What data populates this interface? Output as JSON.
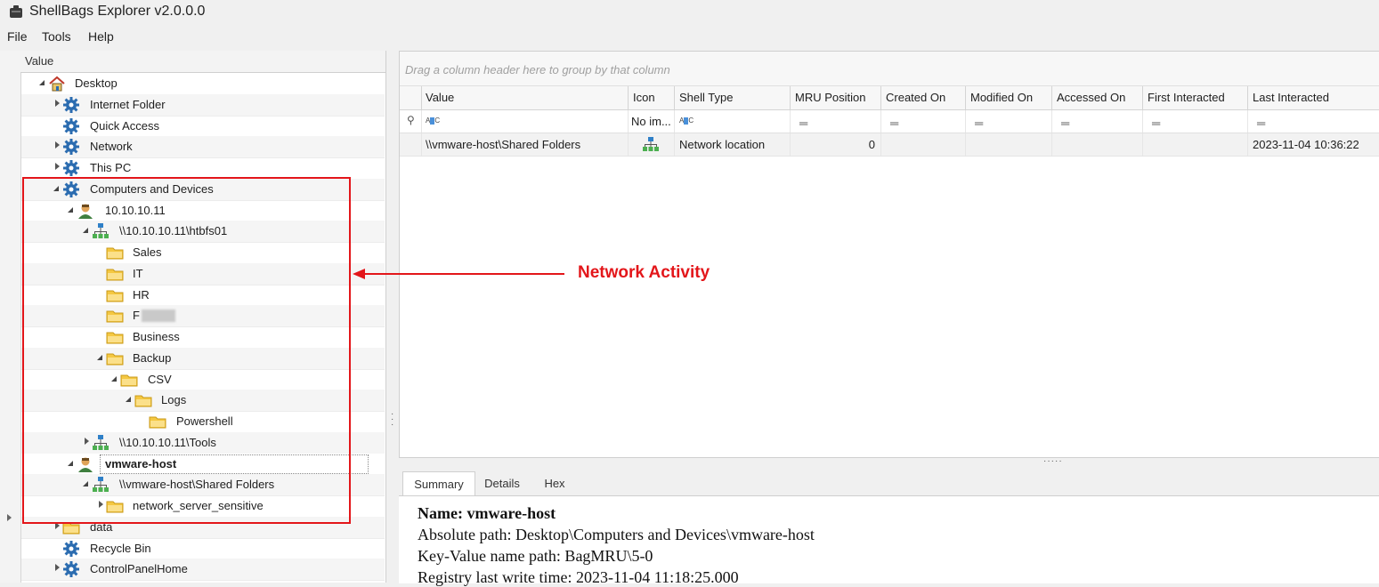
{
  "window": {
    "title": "ShellBags Explorer v2.0.0.0"
  },
  "menu": [
    "File",
    "Tools",
    "Help"
  ],
  "tree": {
    "header": "Value",
    "nodes": [
      {
        "label": "Desktop",
        "icon": "home-icon",
        "level": 0,
        "state": "expanded"
      },
      {
        "label": "Internet Folder",
        "icon": "gear-icon",
        "level": 1,
        "state": "collapsed"
      },
      {
        "label": "Quick Access",
        "icon": "gear-icon",
        "level": 1,
        "state": "none"
      },
      {
        "label": "Network",
        "icon": "gear-icon",
        "level": 1,
        "state": "collapsed"
      },
      {
        "label": "This PC",
        "icon": "gear-icon",
        "level": 1,
        "state": "collapsed"
      },
      {
        "label": "Computers and Devices",
        "icon": "gear-icon",
        "level": 1,
        "state": "expanded"
      },
      {
        "label": "10.10.10.11",
        "icon": "user-icon",
        "level": 2,
        "state": "expanded"
      },
      {
        "label": "\\\\10.10.10.11\\htbfs01",
        "icon": "network-icon",
        "level": 3,
        "state": "expanded"
      },
      {
        "label": "Sales",
        "icon": "folder-icon",
        "level": 4,
        "state": "none"
      },
      {
        "label": "IT",
        "icon": "folder-icon",
        "level": 4,
        "state": "none"
      },
      {
        "label": "HR",
        "icon": "folder-icon",
        "level": 4,
        "state": "none"
      },
      {
        "label": "F",
        "icon": "folder-icon",
        "level": 4,
        "state": "none",
        "redacted": true
      },
      {
        "label": "Business",
        "icon": "folder-icon",
        "level": 4,
        "state": "none"
      },
      {
        "label": "Backup",
        "icon": "folder-icon",
        "level": 4,
        "state": "expanded"
      },
      {
        "label": "CSV",
        "icon": "folder-icon",
        "level": 5,
        "state": "expanded"
      },
      {
        "label": "Logs",
        "icon": "folder-icon",
        "level": 6,
        "state": "expanded"
      },
      {
        "label": "Powershell",
        "icon": "folder-icon",
        "level": 7,
        "state": "none"
      },
      {
        "label": "\\\\10.10.10.11\\Tools",
        "icon": "network-icon",
        "level": 3,
        "state": "collapsed"
      },
      {
        "label": "vmware-host",
        "icon": "user-icon",
        "level": 2,
        "state": "expanded",
        "selected": true
      },
      {
        "label": "\\\\vmware-host\\Shared Folders",
        "icon": "network-icon",
        "level": 3,
        "state": "expanded"
      },
      {
        "label": "network_server_sensitive",
        "icon": "folder-icon",
        "level": 4,
        "state": "collapsed"
      },
      {
        "label": "data",
        "icon": "folder-icon",
        "level": 1,
        "state": "collapsed"
      },
      {
        "label": "Recycle Bin",
        "icon": "gear-icon",
        "level": 1,
        "state": "none"
      },
      {
        "label": "ControlPanelHome",
        "icon": "gear-icon",
        "level": 1,
        "state": "collapsed"
      }
    ]
  },
  "grid": {
    "group_hint": "Drag a column header here to group by that column",
    "columns": [
      "Value",
      "Icon",
      "Shell Type",
      "MRU Position",
      "Created On",
      "Modified On",
      "Accessed On",
      "First Interacted",
      "Last Interacted"
    ],
    "filter_icon_text": "No im...",
    "rows": [
      {
        "value": "\\\\vmware-host\\Shared Folders",
        "icon": "network-icon",
        "shell_type": "Network location",
        "mru_position": "0",
        "created_on": "",
        "modified_on": "",
        "accessed_on": "",
        "first_interacted": "",
        "last_interacted": "2023-11-04 10:36:22"
      }
    ]
  },
  "details": {
    "tabs": [
      "Summary",
      "Details",
      "Hex"
    ],
    "active_tab": "Summary",
    "summary": {
      "name_label": "Name:",
      "name_value": "vmware-host",
      "lines": [
        "Absolute path: Desktop\\Computers and Devices\\vmware-host",
        "Key-Value name path: BagMRU\\5-0",
        "Registry last write time: 2023-11-04 11:18:25.000"
      ]
    }
  },
  "annotation": {
    "text": "Network Activity",
    "color": "#e3161a"
  },
  "colors": {
    "folder": "#f5c842",
    "gear": "#2b6cb0",
    "accent_red": "#e3161a"
  }
}
